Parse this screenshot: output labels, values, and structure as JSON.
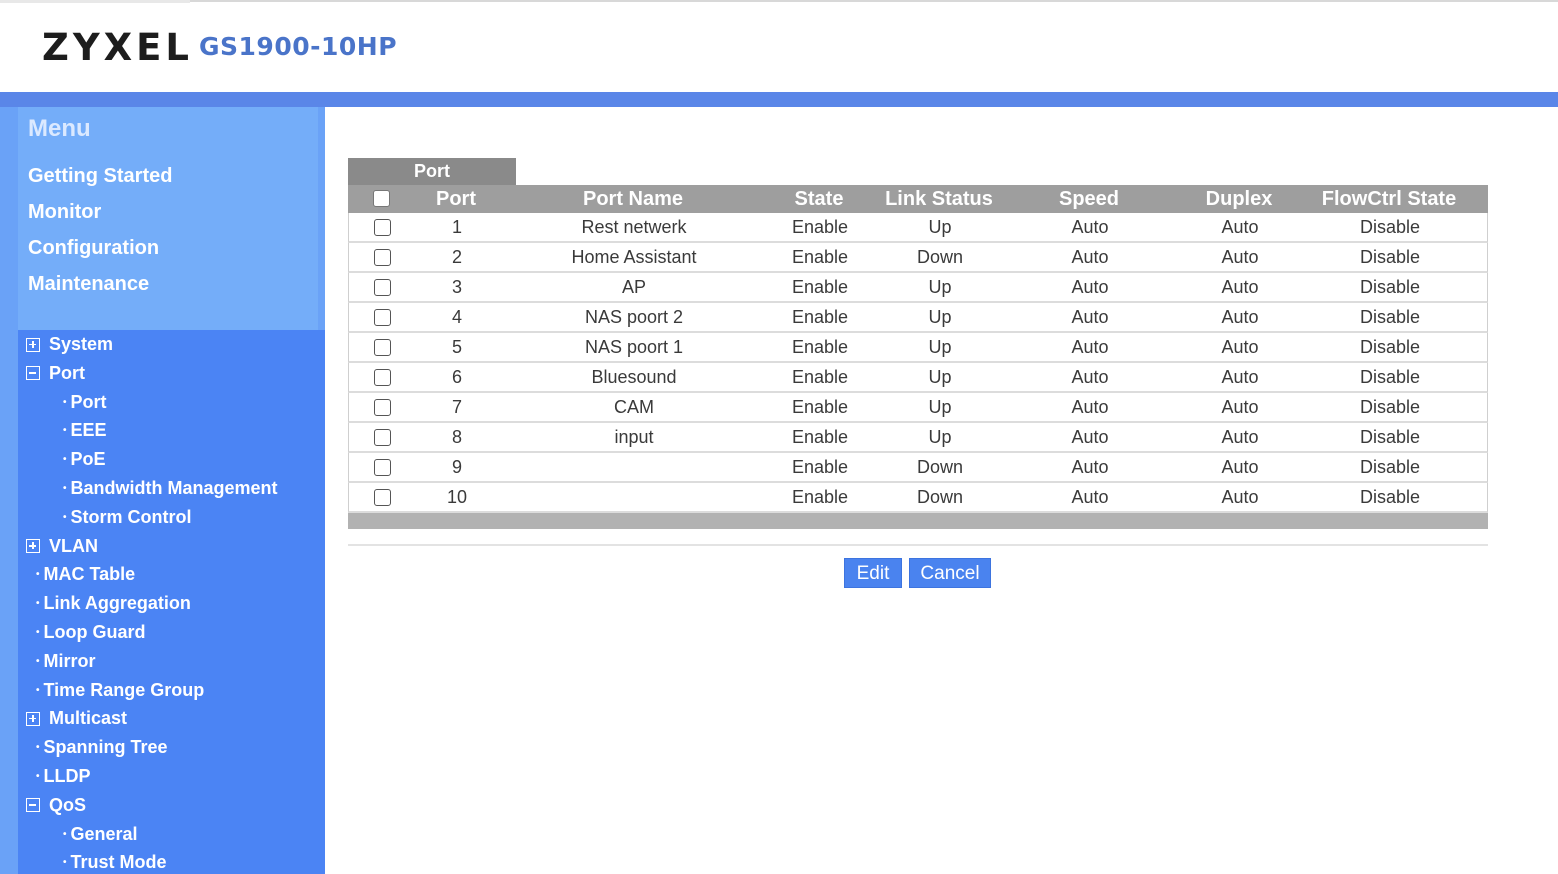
{
  "header": {
    "brand": "ZYXEL",
    "model": "GS1900-10HP"
  },
  "menu": {
    "title": "Menu",
    "links": [
      "Getting Started",
      "Monitor",
      "Configuration",
      "Maintenance"
    ]
  },
  "tree": [
    {
      "label": "System",
      "level": 0,
      "icon": "plus"
    },
    {
      "label": "Port",
      "level": 0,
      "icon": "minus"
    },
    {
      "label": "Port",
      "level": 2,
      "icon": "bullet"
    },
    {
      "label": "EEE",
      "level": 2,
      "icon": "bullet"
    },
    {
      "label": "PoE",
      "level": 2,
      "icon": "bullet"
    },
    {
      "label": "Bandwidth Management",
      "level": 2,
      "icon": "bullet"
    },
    {
      "label": "Storm Control",
      "level": 2,
      "icon": "bullet"
    },
    {
      "label": "VLAN",
      "level": 0,
      "icon": "plus"
    },
    {
      "label": "MAC Table",
      "level": 1,
      "icon": "bullet"
    },
    {
      "label": "Link Aggregation",
      "level": 1,
      "icon": "bullet"
    },
    {
      "label": "Loop Guard",
      "level": 1,
      "icon": "bullet"
    },
    {
      "label": "Mirror",
      "level": 1,
      "icon": "bullet"
    },
    {
      "label": "Time Range Group",
      "level": 1,
      "icon": "bullet"
    },
    {
      "label": "Multicast",
      "level": 0,
      "icon": "plus"
    },
    {
      "label": "Spanning Tree",
      "level": 1,
      "icon": "bullet"
    },
    {
      "label": "LLDP",
      "level": 1,
      "icon": "bullet"
    },
    {
      "label": "QoS",
      "level": 0,
      "icon": "minus"
    },
    {
      "label": "General",
      "level": 2,
      "icon": "bullet"
    },
    {
      "label": "Trust Mode",
      "level": 2,
      "icon": "bullet"
    }
  ],
  "panel": {
    "tab": "Port",
    "columns": [
      "Port",
      "Port Name",
      "State",
      "Link Status",
      "Speed",
      "Duplex",
      "FlowCtrl State"
    ],
    "rows": [
      {
        "port": "1",
        "name": "Rest netwerk",
        "state": "Enable",
        "link": "Up",
        "speed": "Auto",
        "duplex": "Auto",
        "flow": "Disable"
      },
      {
        "port": "2",
        "name": "Home Assistant",
        "state": "Enable",
        "link": "Down",
        "speed": "Auto",
        "duplex": "Auto",
        "flow": "Disable"
      },
      {
        "port": "3",
        "name": "AP",
        "state": "Enable",
        "link": "Up",
        "speed": "Auto",
        "duplex": "Auto",
        "flow": "Disable"
      },
      {
        "port": "4",
        "name": "NAS poort 2",
        "state": "Enable",
        "link": "Up",
        "speed": "Auto",
        "duplex": "Auto",
        "flow": "Disable"
      },
      {
        "port": "5",
        "name": "NAS poort 1",
        "state": "Enable",
        "link": "Up",
        "speed": "Auto",
        "duplex": "Auto",
        "flow": "Disable"
      },
      {
        "port": "6",
        "name": "Bluesound",
        "state": "Enable",
        "link": "Up",
        "speed": "Auto",
        "duplex": "Auto",
        "flow": "Disable"
      },
      {
        "port": "7",
        "name": "CAM",
        "state": "Enable",
        "link": "Up",
        "speed": "Auto",
        "duplex": "Auto",
        "flow": "Disable"
      },
      {
        "port": "8",
        "name": "input",
        "state": "Enable",
        "link": "Up",
        "speed": "Auto",
        "duplex": "Auto",
        "flow": "Disable"
      },
      {
        "port": "9",
        "name": "",
        "state": "Enable",
        "link": "Down",
        "speed": "Auto",
        "duplex": "Auto",
        "flow": "Disable"
      },
      {
        "port": "10",
        "name": "",
        "state": "Enable",
        "link": "Down",
        "speed": "Auto",
        "duplex": "Auto",
        "flow": "Disable"
      }
    ]
  },
  "buttons": {
    "edit": "Edit",
    "cancel": "Cancel"
  }
}
